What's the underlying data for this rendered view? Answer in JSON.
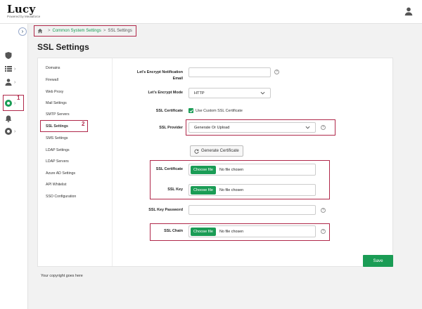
{
  "app": {
    "logo": "Lucy",
    "logo_sub": "Powered by Mediaforce"
  },
  "sidebar": {
    "toggle": "›",
    "markers": {
      "one": "1",
      "two": "2"
    }
  },
  "breadcrumb": {
    "sep1": ">",
    "link": "Common System Settings",
    "sep2": ">",
    "current": "SSL Settings"
  },
  "page": {
    "title": "SSL Settings"
  },
  "subnav": {
    "items": [
      "Domains",
      "Firewall",
      "Web Proxy",
      "Mail Settings",
      "SMTP Servers",
      "SSL Settings",
      "SMS Settings",
      "LDAP Settings",
      "LDAP Servers",
      "Azure AD Settings",
      "API Whitelist",
      "SSO Configuration"
    ],
    "active_index": 5
  },
  "form": {
    "le_email_label_1": "Let's Encrypt Notification",
    "le_email_label_2": "Email",
    "le_mode_label": "Let's Encrypt Mode",
    "le_mode_value": "HTTP",
    "ssl_cert_label": "SSL Certificate",
    "custom_cert_label": "Use Custom SSL Certificate",
    "ssl_provider_label": "SSL Provider",
    "ssl_provider_value": "Generate Or Upload",
    "generate_label": "Generate Certificate",
    "ssl_cert_file_label": "SSL Certificate",
    "ssl_key_label": "SSL Key",
    "ssl_key_password_label": "SSL Key Password",
    "ssl_chain_label": "SSL Chain",
    "choose_file": "Choose file",
    "no_file": "No file chosen",
    "help": "?"
  },
  "footer": {
    "save": "Save",
    "copyright": "Your copyright goes here"
  },
  "colors": {
    "accent": "#1a9c55",
    "highlight": "#b0284a"
  }
}
